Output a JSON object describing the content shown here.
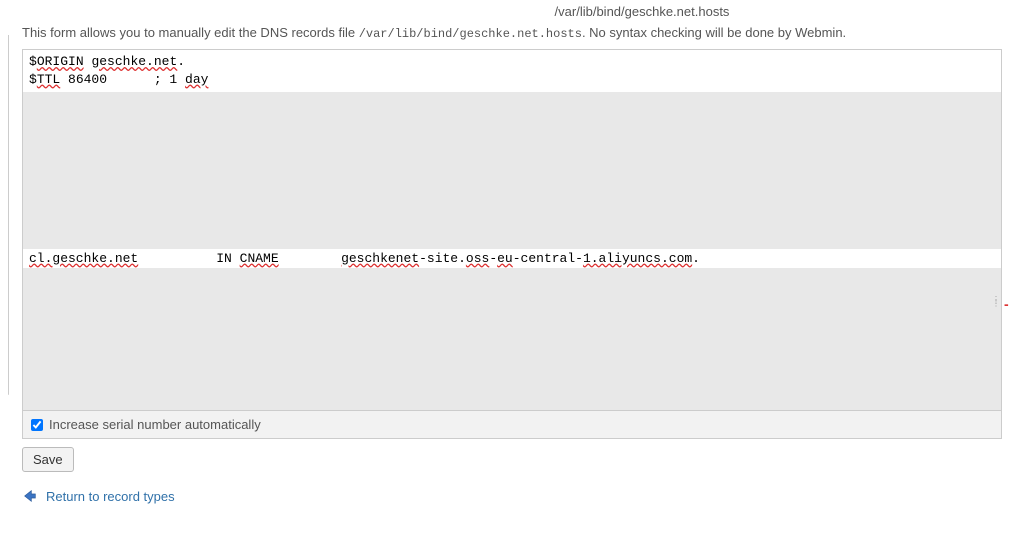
{
  "header": {
    "file_path": "/var/lib/bind/geschke.net.hosts"
  },
  "intro": {
    "prefix": "This form allows you to manually edit the DNS records file ",
    "path_mono": "/var/lib/bind/geschke.net.hosts",
    "suffix": ". No syntax checking will be done by Webmin."
  },
  "zone_file": {
    "line1_a": "$",
    "line1_b": "ORIGIN",
    "line1_c": " ",
    "line1_d": "geschke.net",
    "line1_e": ".",
    "line2_a": "$",
    "line2_b": "TTL",
    "line2_c": " 86400      ; 1 ",
    "line2_d": "day",
    "cname_a": "cl.geschke.net",
    "cname_b": "          IN ",
    "cname_c": "CNAME",
    "cname_d": "        ",
    "cname_e": "geschkenet",
    "cname_f": "-site.",
    "cname_g": "oss",
    "cname_h": "-",
    "cname_i": "eu",
    "cname_j": "-central-",
    "cname_k": "1.aliyuncs.com",
    "cname_l": "."
  },
  "footer": {
    "serial_label": "Increase serial number automatically",
    "serial_checked": true
  },
  "actions": {
    "save_label": "Save",
    "return_label": "Return to record types"
  },
  "colors": {
    "link": "#3071a9",
    "arrow": "#3071a9"
  }
}
